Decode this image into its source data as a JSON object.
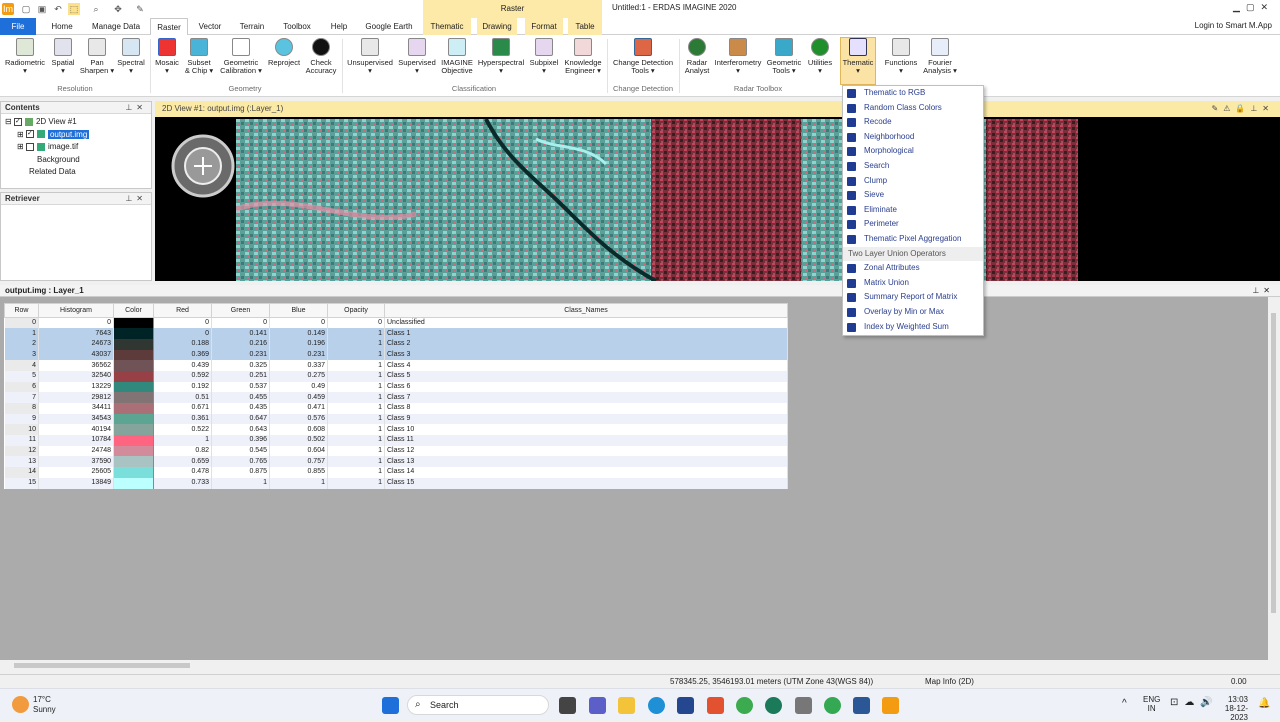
{
  "app": {
    "window_title": "Untitled:1 - ERDAS IMAGINE 2020",
    "context_tab_group": "Raster",
    "login": "Login to Smart M.App"
  },
  "tabs": [
    "File",
    "Home",
    "Manage Data",
    "Raster",
    "Vector",
    "Terrain",
    "Toolbox",
    "Help",
    "Google Earth",
    "Thematic",
    "Drawing",
    "Format",
    "Table"
  ],
  "ribbon": {
    "buttons": [
      {
        "label": "Radiometric",
        "sub": "▾"
      },
      {
        "label": "Spatial",
        "sub": "▾"
      },
      {
        "label": "Pan\nSharpen ▾",
        "sub": ""
      },
      {
        "label": "Spectral",
        "sub": "▾"
      },
      {
        "label": "Mosaic",
        "sub": "▾"
      },
      {
        "label": "Subset\n& Chip ▾",
        "sub": ""
      },
      {
        "label": "Geometric\nCalibration ▾",
        "sub": ""
      },
      {
        "label": "Reproject",
        "sub": ""
      },
      {
        "label": "Check\nAccuracy",
        "sub": ""
      },
      {
        "label": "Unsupervised",
        "sub": "▾"
      },
      {
        "label": "Supervised",
        "sub": "▾"
      },
      {
        "label": "IMAGINE\nObjective",
        "sub": ""
      },
      {
        "label": "Hyperspectral",
        "sub": "▾"
      },
      {
        "label": "Subpixel",
        "sub": "▾"
      },
      {
        "label": "Knowledge\nEngineer ▾",
        "sub": ""
      },
      {
        "label": "Change Detection\nTools ▾",
        "sub": ""
      },
      {
        "label": "Radar\nAnalyst",
        "sub": ""
      },
      {
        "label": "Interferometry",
        "sub": "▾"
      },
      {
        "label": "Geometric\nTools ▾",
        "sub": ""
      },
      {
        "label": "Utilities",
        "sub": "▾"
      },
      {
        "label": "Thematic",
        "sub": "▾"
      },
      {
        "label": "Functions",
        "sub": "▾"
      },
      {
        "label": "Fourier\nAnalysis ▾",
        "sub": ""
      }
    ],
    "groups": [
      "Resolution",
      "Geometry",
      "Classification",
      "Change Detection",
      "Radar Toolbox"
    ]
  },
  "contents": {
    "title": "Contents",
    "items": [
      "2D View #1",
      "output.img",
      "image.tif",
      "Background",
      "Related Data"
    ]
  },
  "retriever": {
    "title": "Retriever"
  },
  "view": {
    "title": "2D View #1: output.img (:Layer_1)"
  },
  "attribute_table": {
    "title": "output.img : Layer_1",
    "columns": [
      "Row",
      "Histogram",
      "Color",
      "Red",
      "Green",
      "Blue",
      "Opacity",
      "Class_Names"
    ],
    "rows": [
      {
        "row": "0",
        "hist": "0",
        "color": "#000000",
        "red": "0",
        "green": "0",
        "blue": "0",
        "op": "0",
        "name": "Unclassified"
      },
      {
        "row": "1",
        "hist": "7643",
        "color": "#002426",
        "red": "0",
        "green": "0.141",
        "blue": "0.149",
        "op": "1",
        "name": "Class 1"
      },
      {
        "row": "2",
        "hist": "24673",
        "color": "#303732",
        "red": "0.188",
        "green": "0.216",
        "blue": "0.196",
        "op": "1",
        "name": "Class 2"
      },
      {
        "row": "3",
        "hist": "43037",
        "color": "#5e3b3b",
        "red": "0.369",
        "green": "0.231",
        "blue": "0.231",
        "op": "1",
        "name": "Class 3"
      },
      {
        "row": "4",
        "hist": "36562",
        "color": "#705356",
        "red": "0.439",
        "green": "0.325",
        "blue": "0.337",
        "op": "1",
        "name": "Class 4"
      },
      {
        "row": "5",
        "hist": "32540",
        "color": "#974046",
        "red": "0.592",
        "green": "0.251",
        "blue": "0.275",
        "op": "1",
        "name": "Class 5"
      },
      {
        "row": "6",
        "hist": "13229",
        "color": "#31897d",
        "red": "0.192",
        "green": "0.537",
        "blue": "0.49",
        "op": "1",
        "name": "Class 6"
      },
      {
        "row": "7",
        "hist": "29812",
        "color": "#827475",
        "red": "0.51",
        "green": "0.455",
        "blue": "0.459",
        "op": "1",
        "name": "Class 7"
      },
      {
        "row": "8",
        "hist": "34411",
        "color": "#ab6f78",
        "red": "0.671",
        "green": "0.435",
        "blue": "0.471",
        "op": "1",
        "name": "Class 8"
      },
      {
        "row": "9",
        "hist": "34543",
        "color": "#5ca593",
        "red": "0.361",
        "green": "0.647",
        "blue": "0.576",
        "op": "1",
        "name": "Class 9"
      },
      {
        "row": "10",
        "hist": "40194",
        "color": "#85a49b",
        "red": "0.522",
        "green": "0.643",
        "blue": "0.608",
        "op": "1",
        "name": "Class 10"
      },
      {
        "row": "11",
        "hist": "10784",
        "color": "#ff6580",
        "red": "1",
        "green": "0.396",
        "blue": "0.502",
        "op": "1",
        "name": "Class 11"
      },
      {
        "row": "12",
        "hist": "24748",
        "color": "#d18b9a",
        "red": "0.82",
        "green": "0.545",
        "blue": "0.604",
        "op": "1",
        "name": "Class 12"
      },
      {
        "row": "13",
        "hist": "37590",
        "color": "#a8c3c1",
        "red": "0.659",
        "green": "0.765",
        "blue": "0.757",
        "op": "1",
        "name": "Class 13"
      },
      {
        "row": "14",
        "hist": "25605",
        "color": "#7adfda",
        "red": "0.478",
        "green": "0.875",
        "blue": "0.855",
        "op": "1",
        "name": "Class 14"
      },
      {
        "row": "15",
        "hist": "13849",
        "color": "#bbffff",
        "red": "0.733",
        "green": "1",
        "blue": "1",
        "op": "1",
        "name": "Class 15"
      }
    ]
  },
  "thematic_menu": {
    "items": [
      "Thematic to RGB",
      "Random Class Colors",
      "Recode",
      "Neighborhood",
      "Morphological",
      "Search",
      "Clump",
      "Sieve",
      "Eliminate",
      "Perimeter",
      "Thematic Pixel Aggregation"
    ],
    "section": "Two Layer Union Operators",
    "items2": [
      "Zonal Attributes",
      "Matrix Union",
      "Summary Report of Matrix",
      "Overlay by Min or Max",
      "Index by Weighted Sum"
    ]
  },
  "status": {
    "coords": "578345.25, 3546193.01 meters (UTM Zone 43(WGS 84))",
    "mapinfo": "Map Info (2D)",
    "value": "0.00"
  },
  "taskbar": {
    "temp": "17°C",
    "weather": "Sunny",
    "search": "Search",
    "lang1": "ENG",
    "lang2": "IN",
    "time": "13:03",
    "date": "18-12-2023"
  }
}
